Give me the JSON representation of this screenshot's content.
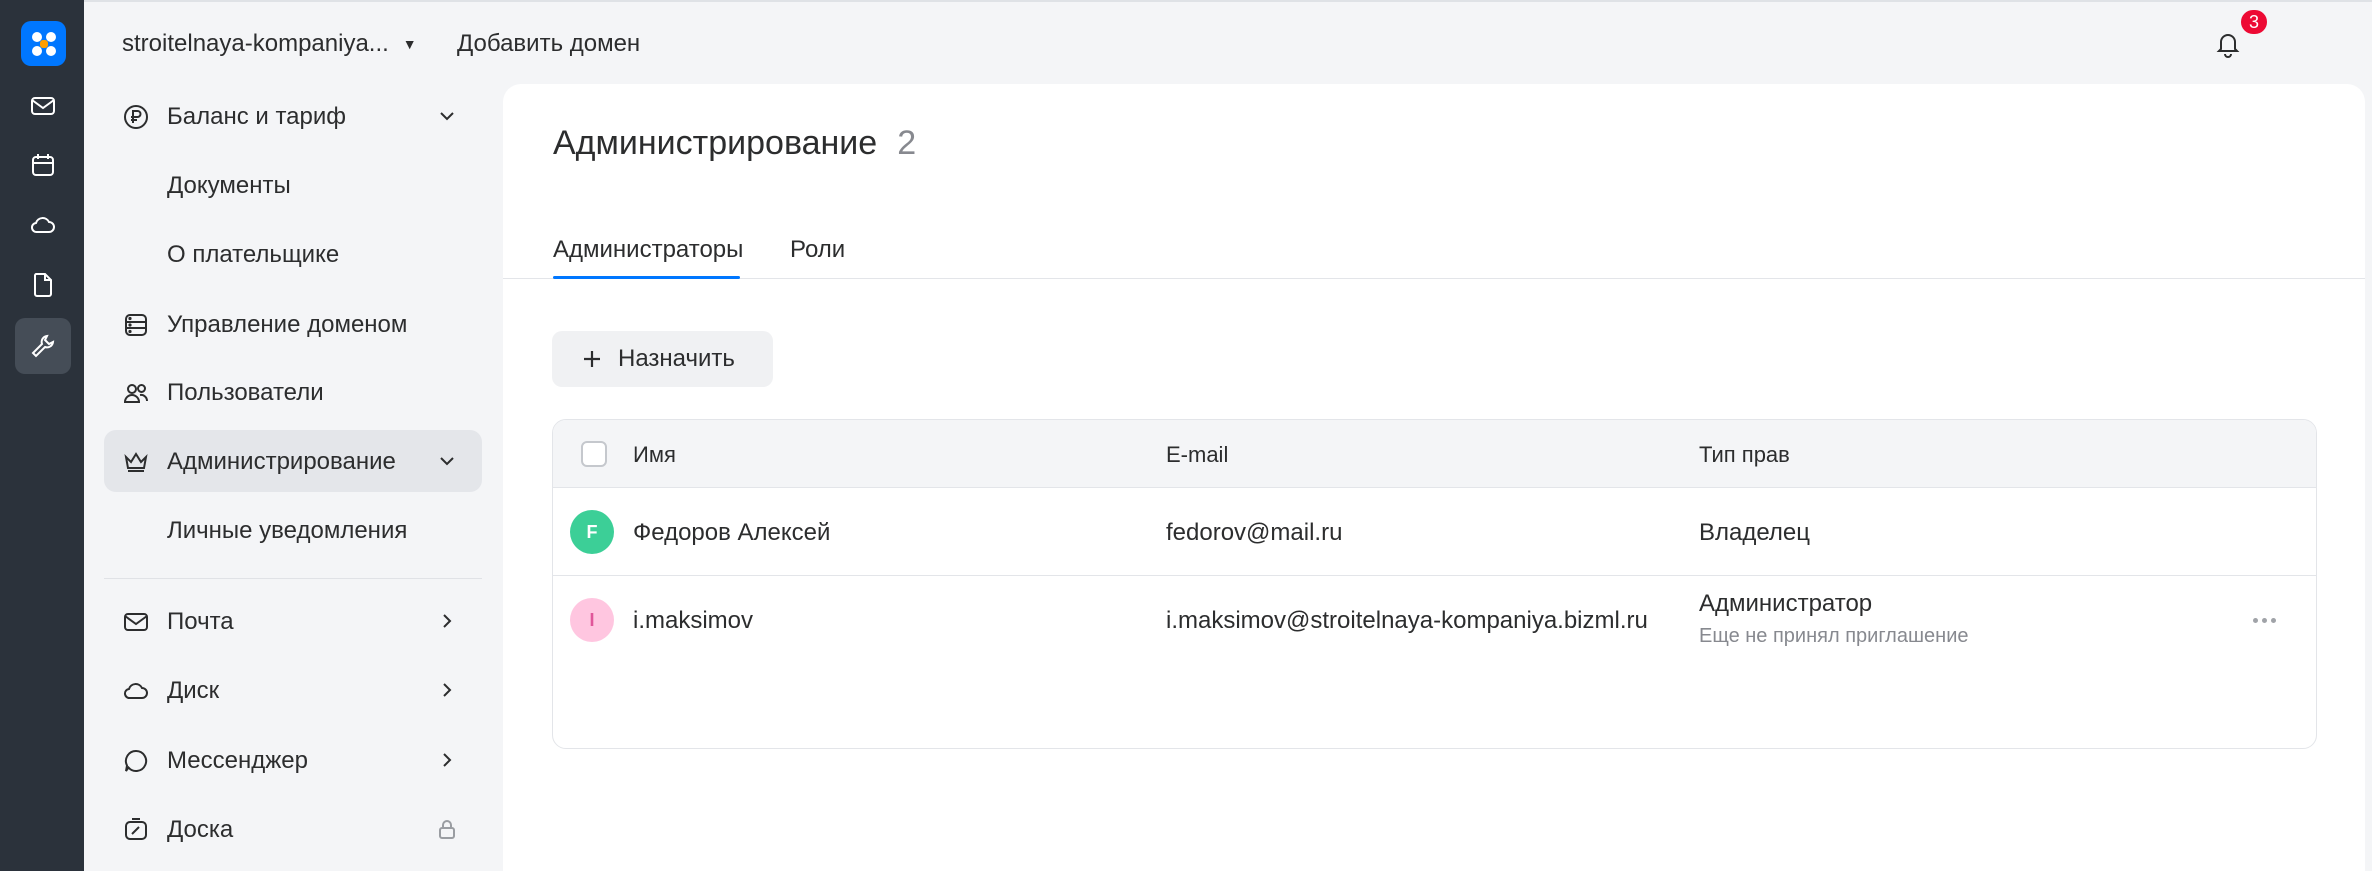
{
  "topbar": {
    "org_name": "stroitelnaya-kompaniya...",
    "add_domain": "Добавить домен",
    "notifications_count": "3"
  },
  "rail": {
    "items": [
      "logo-icon",
      "mail-icon",
      "calendar-icon",
      "cloud-icon",
      "document-icon",
      "wrench-icon"
    ],
    "active": "wrench-icon"
  },
  "sidebar": {
    "items": [
      {
        "label": "Баланс и тариф",
        "icon": "ruble-icon",
        "chevron": "down"
      },
      {
        "label": "Документы"
      },
      {
        "label": "О плательщике"
      },
      {
        "label": "Управление доменом",
        "icon": "domain-icon"
      },
      {
        "label": "Пользователи",
        "icon": "users-icon"
      },
      {
        "label": "Администрирование",
        "icon": "crown-icon",
        "chevron": "down",
        "active": true
      },
      {
        "label": "Личные уведомления"
      },
      {
        "label": "Почта",
        "icon": "mail-icon",
        "chevron": "right"
      },
      {
        "label": "Диск",
        "icon": "cloud-icon",
        "chevron": "right"
      },
      {
        "label": "Мессенджер",
        "icon": "chat-icon",
        "chevron": "right"
      },
      {
        "label": "Доска",
        "icon": "board-icon",
        "trailing": "lock-icon"
      }
    ]
  },
  "main": {
    "title": "Администрирование",
    "count": "2",
    "tabs": [
      "Администраторы",
      "Роли"
    ],
    "active_tab": "Администраторы",
    "assign_button": "Назначить",
    "table": {
      "headers": [
        "Имя",
        "E-mail",
        "Тип прав"
      ],
      "rows": [
        {
          "initial": "F",
          "avatar_color": "#3ccf97",
          "name": "Федоров Алексей",
          "email": "fedorov@mail.ru",
          "role": "Владелец",
          "note": ""
        },
        {
          "initial": "I",
          "avatar_color": "#ffc6e0",
          "name": "i.maksimov",
          "email": "i.maksimov@stroitelnaya-kompaniya.bizml.ru",
          "role": "Администратор",
          "note": "Еще не принял приглашение"
        }
      ]
    }
  },
  "colors": {
    "accent": "#0077ff",
    "rail_bg": "#2b323b",
    "badge": "#ed0a34"
  }
}
